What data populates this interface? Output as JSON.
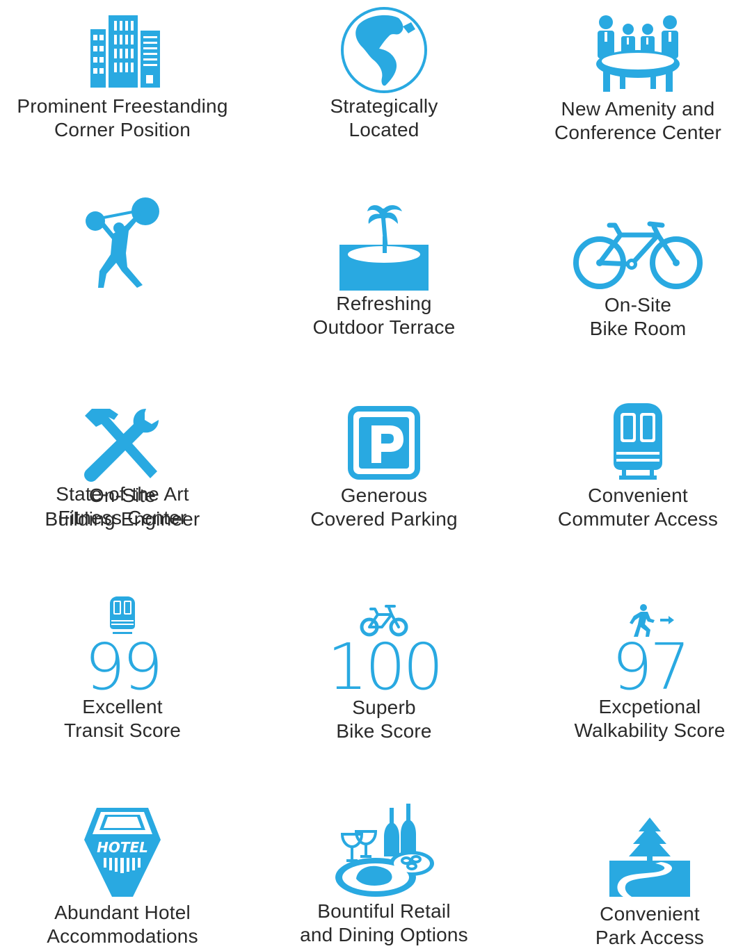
{
  "accent_color": "#29a9e1",
  "features": [
    {
      "icon": "office-buildings-icon",
      "line1": "Prominent Freestanding",
      "line2": "Corner Position"
    },
    {
      "icon": "globe-icon",
      "line1": "Strategically",
      "line2": "Located"
    },
    {
      "icon": "conference-table-icon",
      "line1": "New Amenity and",
      "line2": "Conference Center"
    },
    {
      "icon": "weightlifter-icon",
      "line1": "State-of-the Art",
      "line2": "Fitness Center"
    },
    {
      "icon": "palm-tree-island-icon",
      "line1": "Refreshing",
      "line2": "Outdoor Terrace"
    },
    {
      "icon": "bicycle-icon",
      "line1": "On-Site",
      "line2": "Bike Room"
    },
    {
      "icon": "hammer-wrench-icon",
      "line1": "On-Site",
      "line2": "Building Engineer"
    },
    {
      "icon": "parking-sign-icon",
      "line1": "Generous",
      "line2": "Covered Parking"
    },
    {
      "icon": "train-icon",
      "line1": "Convenient",
      "line2": "Commuter Access"
    }
  ],
  "scores": [
    {
      "icon": "train-small-icon",
      "value": "99",
      "line1": "Excellent",
      "line2": "Transit Score"
    },
    {
      "icon": "bike-small-icon",
      "value": "100",
      "line1": "Superb",
      "line2": "Bike Score"
    },
    {
      "icon": "walking-person-icon",
      "value": "97",
      "line1": "Excpetional",
      "line2": "Walkability Score"
    }
  ],
  "bottom": [
    {
      "icon": "hotel-icon",
      "line1": "Abundant Hotel",
      "line2": "Accommodations"
    },
    {
      "icon": "dining-wine-icon",
      "line1": "Bountiful Retail",
      "line2": "and Dining Options"
    },
    {
      "icon": "park-tree-path-icon",
      "line1": "Convenient",
      "line2": "Park Access"
    }
  ]
}
